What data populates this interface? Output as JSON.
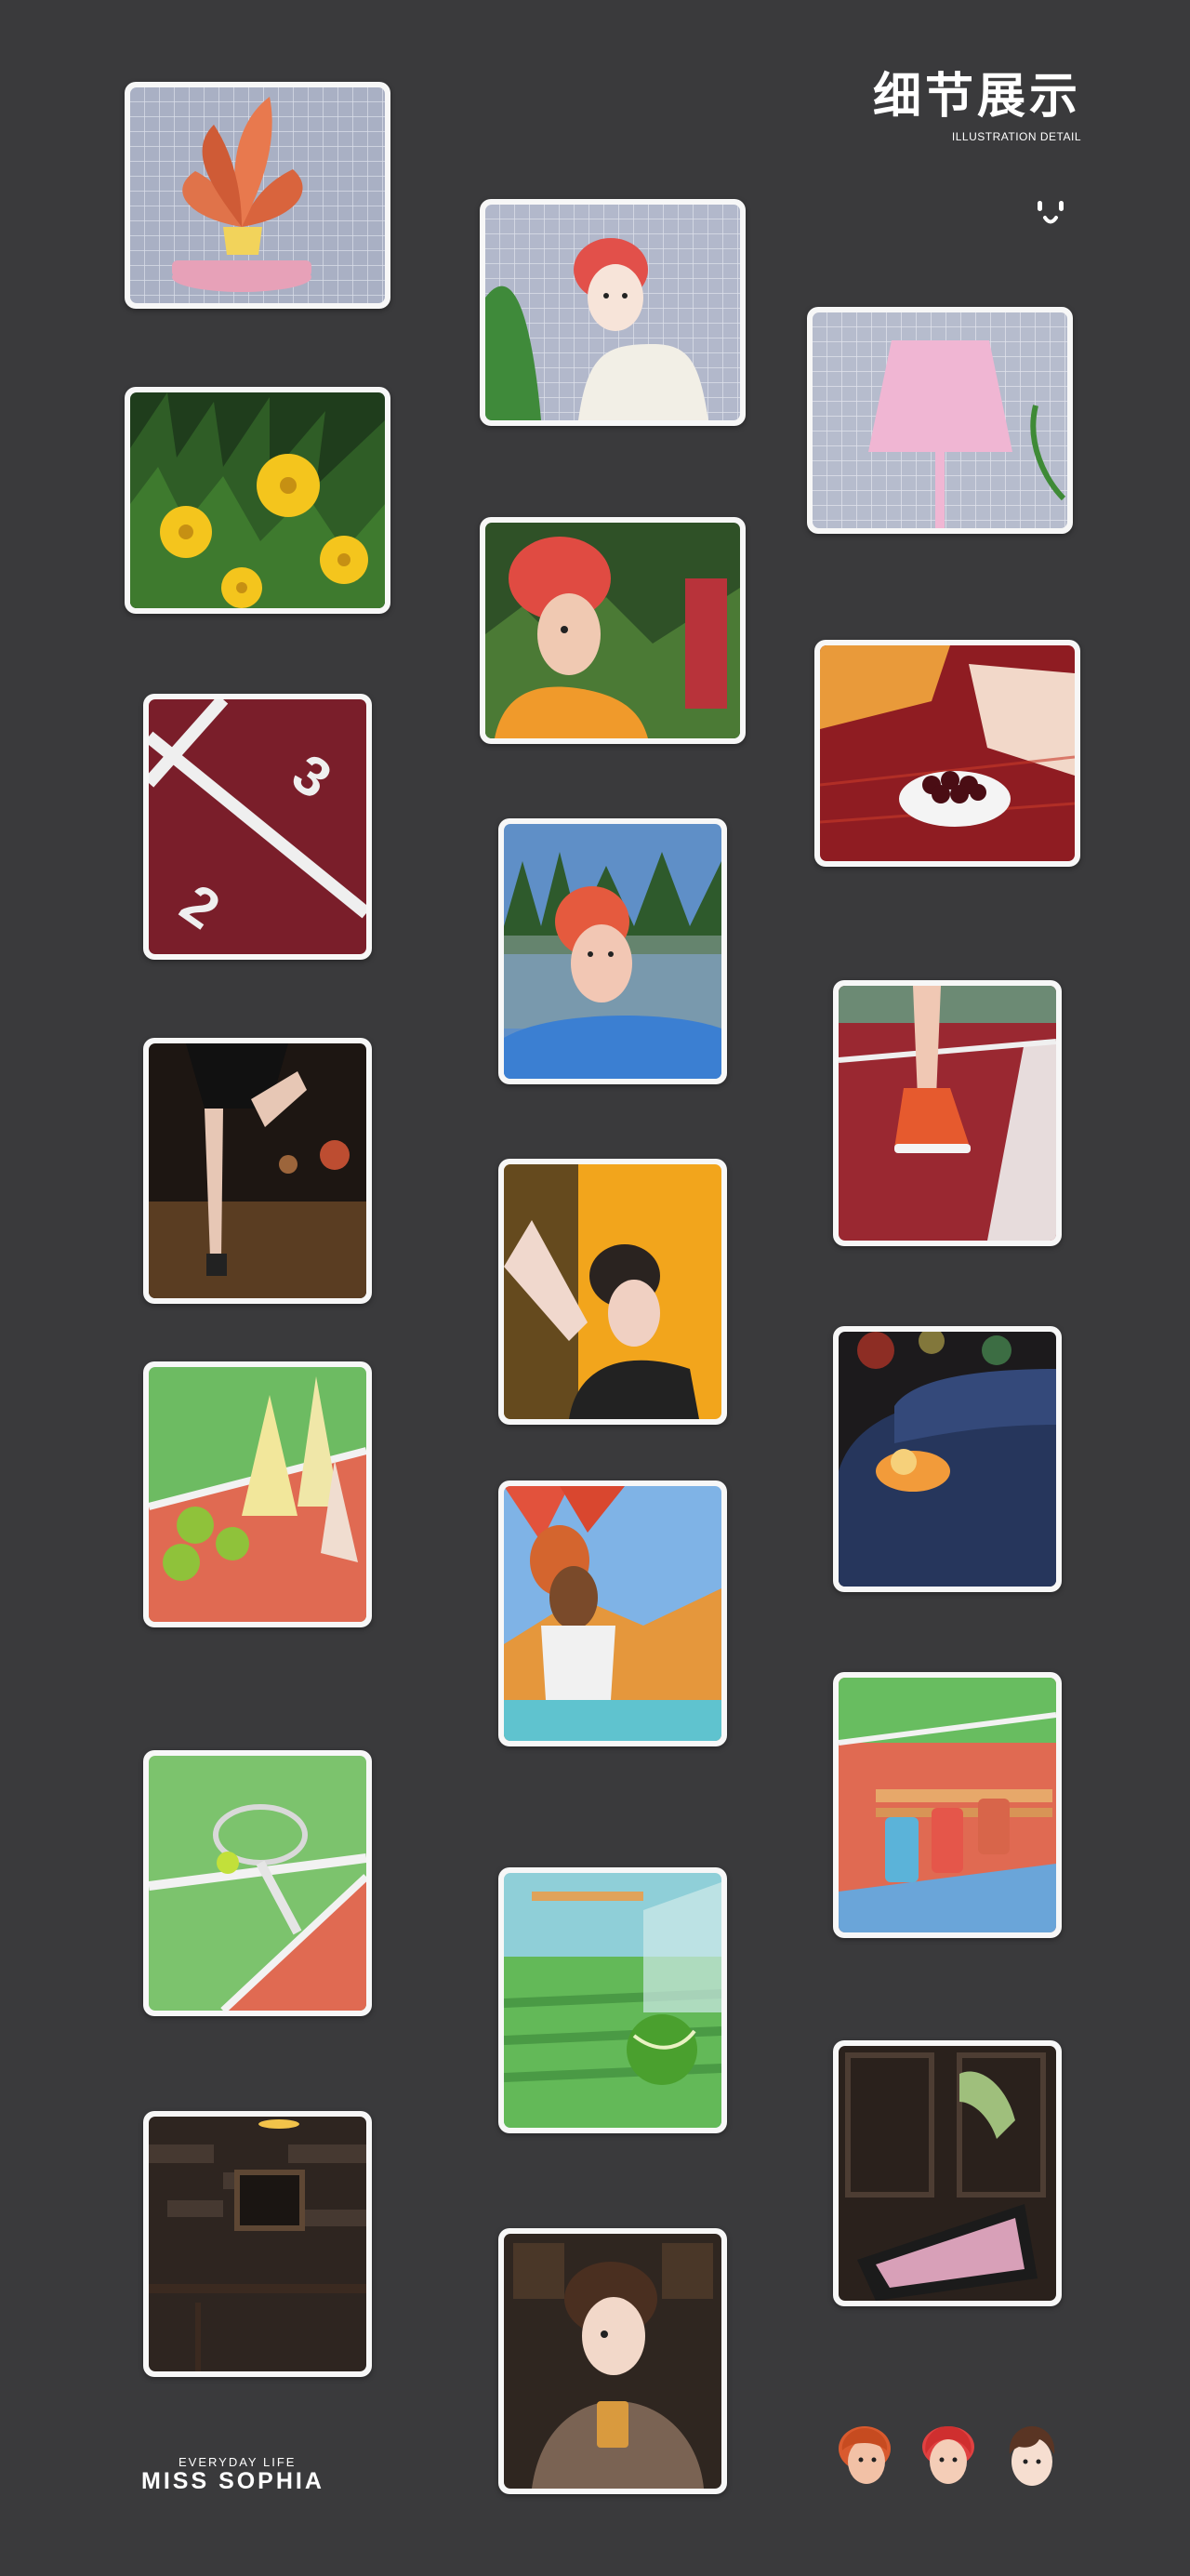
{
  "header": {
    "title_cn": "细节展示",
    "subtitle_en": "ILLUSTRATION DETAIL",
    "mark_icon": "smile-face-icon"
  },
  "footer": {
    "tagline": "EVERYDAY LIFE",
    "brand": "MISS  SOPHIA",
    "avatars": [
      "orange-curly-avatar-icon",
      "red-hair-avatar-icon",
      "brown-hair-avatar-icon"
    ]
  },
  "tiles": [
    {
      "subject": "plant-pot-on-tile-wall"
    },
    {
      "subject": "yellow-flowers"
    },
    {
      "subject": "court-numbers-3-2"
    },
    {
      "subject": "legs-at-night"
    },
    {
      "subject": "traffic-cones-tennis-balls"
    },
    {
      "subject": "tennis-racket"
    },
    {
      "subject": "cafe-wall"
    },
    {
      "subject": "girl-with-plant"
    },
    {
      "subject": "girl-reading-book"
    },
    {
      "subject": "boy-on-court"
    },
    {
      "subject": "girl-at-sunset"
    },
    {
      "subject": "girl-on-beach"
    },
    {
      "subject": "tennis-ball-near-net"
    },
    {
      "subject": "man-with-coffee"
    },
    {
      "subject": "pink-lamp"
    },
    {
      "subject": "cherries-bowl"
    },
    {
      "subject": "red-sneaker-on-court"
    },
    {
      "subject": "blue-car-bokeh"
    },
    {
      "subject": "cans-on-bench"
    },
    {
      "subject": "window-tablet"
    }
  ],
  "colors": {
    "background": "#3a3a3c",
    "frame": "#f7f7f7",
    "court_green": "#6dbb62",
    "court_red": "#e06a52"
  }
}
